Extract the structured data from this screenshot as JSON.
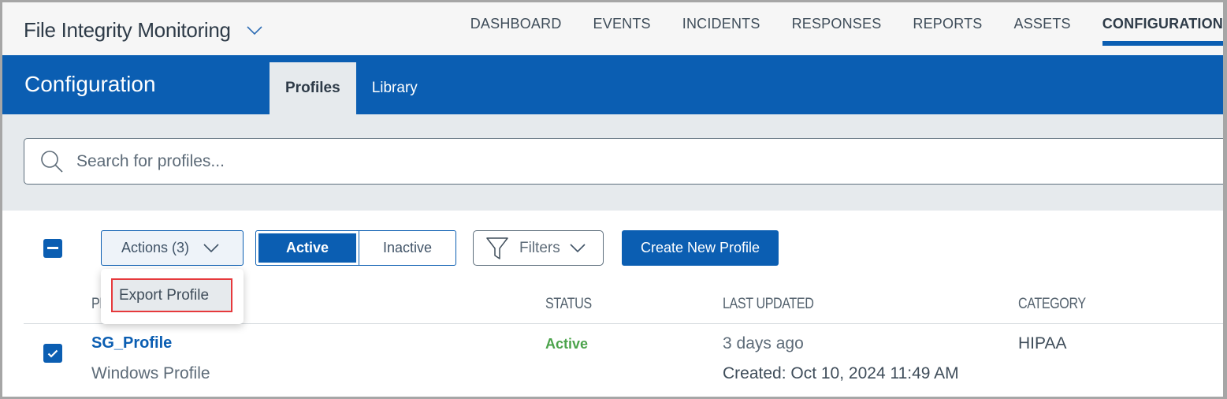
{
  "app": {
    "title": "File Integrity Monitoring",
    "title_icon": "chevron-down-icon"
  },
  "nav": {
    "items": [
      {
        "label": "DASHBOARD",
        "active": false
      },
      {
        "label": "EVENTS",
        "active": false
      },
      {
        "label": "INCIDENTS",
        "active": false
      },
      {
        "label": "RESPONSES",
        "active": false
      },
      {
        "label": "REPORTS",
        "active": false
      },
      {
        "label": "ASSETS",
        "active": false
      },
      {
        "label": "CONFIGURATION",
        "active": true
      }
    ]
  },
  "header": {
    "section_title": "Configuration",
    "tabs": [
      {
        "label": "Profiles",
        "active": true
      },
      {
        "label": "Library",
        "active": false
      }
    ]
  },
  "search": {
    "placeholder": "Search for profiles...",
    "value": "",
    "icon": "search-icon"
  },
  "toolbar": {
    "select_all_state": "indeterminate",
    "actions_label": "Actions (3)",
    "status_toggle": {
      "options": [
        "Active",
        "Inactive"
      ],
      "selected": "Active"
    },
    "filters_label": "Filters",
    "create_label": "Create New Profile"
  },
  "actions_menu": {
    "open": true,
    "items": [
      {
        "label": "Export Profile",
        "highlighted": true
      }
    ]
  },
  "table": {
    "columns": [
      "PROFILE",
      "STATUS",
      "LAST UPDATED",
      "CATEGORY"
    ],
    "rows": [
      {
        "checked": true,
        "name": "SG_Profile",
        "type": "Windows Profile",
        "status": "Active",
        "last_updated": "3 days ago",
        "created": "Created: Oct 10, 2024 11:49 AM",
        "category": "HIPAA"
      }
    ]
  },
  "colors": {
    "brand_blue": "#0b5eb2",
    "status_active": "#4ba34b",
    "highlight_border": "#e6393c",
    "band_grey": "#e6eaed"
  }
}
